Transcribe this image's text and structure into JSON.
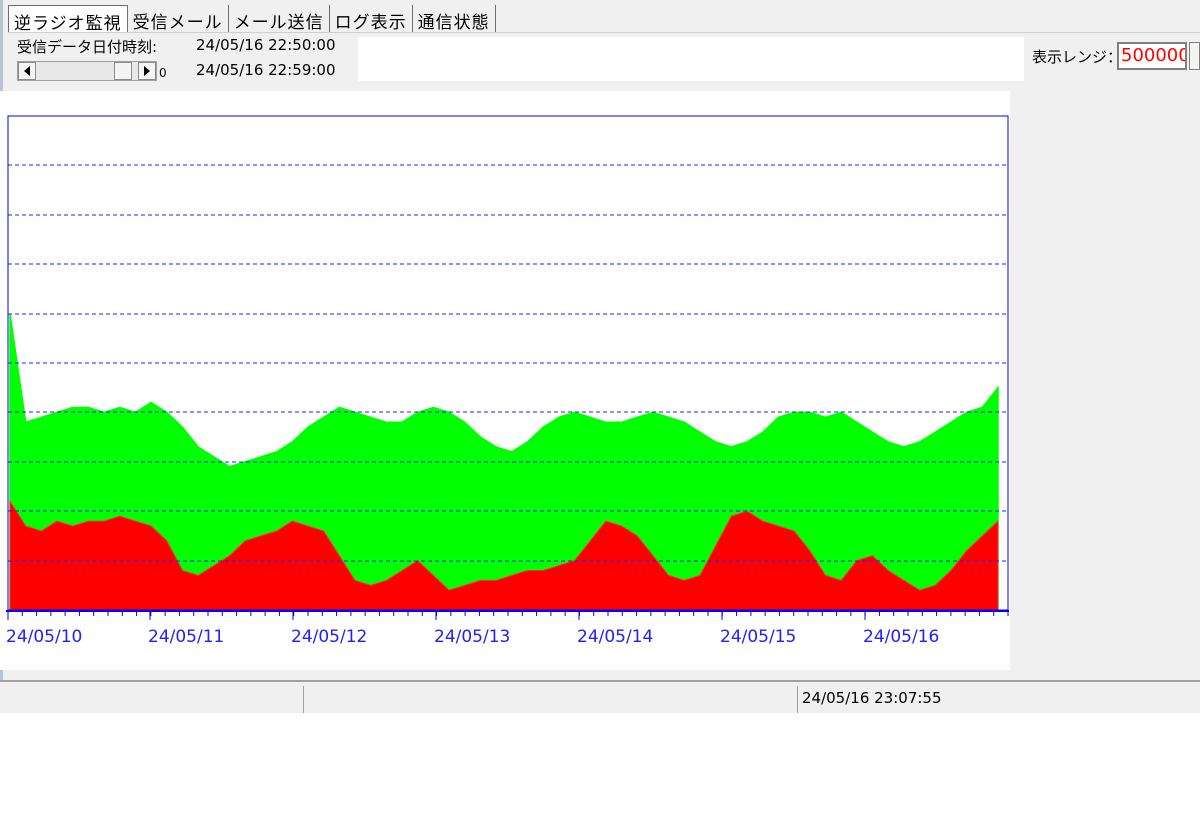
{
  "tabs": [
    {
      "label": "逆ラジオ監視",
      "active": true
    },
    {
      "label": "受信メール",
      "active": false
    },
    {
      "label": "メール送信",
      "active": false
    },
    {
      "label": "ログ表示",
      "active": false
    },
    {
      "label": "通信状態",
      "active": false
    }
  ],
  "header": {
    "received_label": "受信データ日付時刻:",
    "received_start": "24/05/16 22:50:00",
    "received_end": "24/05/16 22:59:00",
    "scroll_value": "0",
    "range_label": "表示レンジ：",
    "range_value": "500000"
  },
  "colors": {
    "green": "#00ff00",
    "red": "#ff0000",
    "axis": "#0000ff",
    "grid": "#2020ff"
  },
  "chart_data": {
    "type": "area",
    "stacked": true,
    "x_tick_labels": [
      "24/05/10",
      "24/05/11",
      "24/05/12",
      "24/05/13",
      "24/05/14",
      "24/05/15",
      "24/05/16"
    ],
    "grid": "horizontal dashed",
    "series": [
      {
        "color": "green",
        "values": [
          0.6,
          0.38,
          0.39,
          0.4,
          0.41,
          0.41,
          0.4,
          0.41,
          0.4,
          0.42,
          0.4,
          0.37,
          0.33,
          0.31,
          0.29,
          0.3,
          0.31,
          0.32,
          0.34,
          0.37,
          0.39,
          0.41,
          0.4,
          0.39,
          0.38,
          0.38,
          0.4,
          0.41,
          0.4,
          0.38,
          0.35,
          0.33,
          0.32,
          0.34,
          0.37,
          0.39,
          0.4,
          0.39,
          0.38,
          0.38,
          0.39,
          0.4,
          0.39,
          0.38,
          0.36,
          0.34,
          0.33,
          0.34,
          0.36,
          0.39,
          0.4,
          0.4,
          0.39,
          0.4,
          0.38,
          0.36,
          0.34,
          0.33,
          0.34,
          0.36,
          0.38,
          0.4,
          0.41,
          0.45
        ]
      },
      {
        "color": "red",
        "values": [
          0.22,
          0.17,
          0.16,
          0.18,
          0.17,
          0.18,
          0.18,
          0.19,
          0.18,
          0.17,
          0.14,
          0.08,
          0.07,
          0.09,
          0.11,
          0.14,
          0.15,
          0.16,
          0.18,
          0.17,
          0.16,
          0.11,
          0.06,
          0.05,
          0.06,
          0.08,
          0.1,
          0.07,
          0.04,
          0.05,
          0.06,
          0.06,
          0.07,
          0.08,
          0.08,
          0.09,
          0.1,
          0.14,
          0.18,
          0.17,
          0.15,
          0.11,
          0.07,
          0.06,
          0.07,
          0.13,
          0.19,
          0.2,
          0.18,
          0.17,
          0.16,
          0.12,
          0.07,
          0.06,
          0.1,
          0.11,
          0.08,
          0.06,
          0.04,
          0.05,
          0.08,
          0.12,
          0.15,
          0.18
        ]
      }
    ]
  },
  "status": {
    "timestamp": "24/05/16 23:07:55"
  }
}
